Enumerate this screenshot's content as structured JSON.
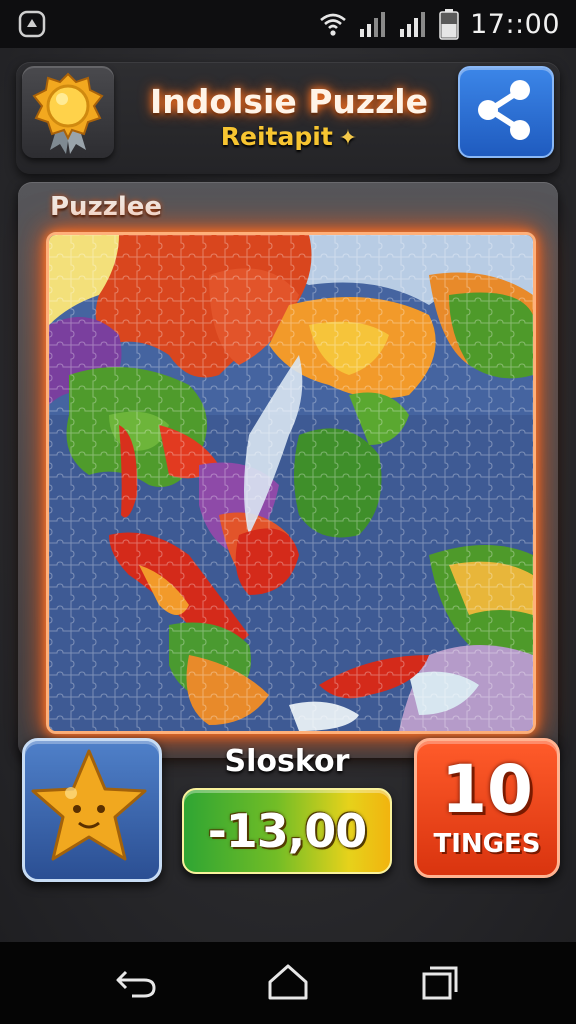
{
  "status_bar": {
    "time": "17::00",
    "icons": [
      "app-badge-icon",
      "wifi-icon",
      "signal-icon",
      "signal-icon-2",
      "battery-icon"
    ]
  },
  "header": {
    "title": "Indolsie Puzzle",
    "subtitle": "Reitapit",
    "subtitle_icon": "sparkle-icon",
    "left_icon": "medal-icon",
    "right_icon": "share-icon"
  },
  "puzzle": {
    "label": "Puzzlee",
    "image": "world-map-jigsaw"
  },
  "bottom": {
    "star_icon": "star-icon",
    "score_label": "Slоskor",
    "score_value": "-13,00",
    "timer_value": "10",
    "timer_label": "TINGES"
  },
  "nav": {
    "icons": [
      "back-icon",
      "home-icon",
      "recents-icon"
    ]
  },
  "colors": {
    "accent_orange": "#ff7a2a",
    "share_blue": "#2f73d6",
    "score_green": "#2fa533",
    "score_yellow": "#f1b40f",
    "timer_red": "#e8401a"
  }
}
